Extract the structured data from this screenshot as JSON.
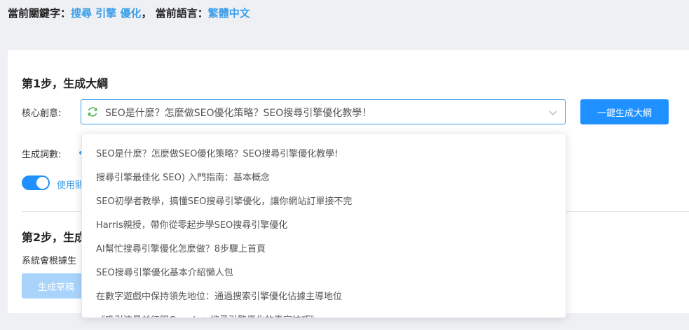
{
  "topbar": {
    "keyword_label": "當前關鍵字：",
    "keyword_value": "搜尋 引擎 優化",
    "separator": "，",
    "language_label": "當前語言：",
    "language_value": "繁體中文"
  },
  "step1": {
    "title": "第1步，生成大綱",
    "core_idea_label": "核心創意:",
    "core_idea_value": "SEO是什麼？怎麼做SEO優化策略？SEO搜尋引擎優化教學！",
    "generate_outline_button": "一鍵生成大綱",
    "word_count_label": "生成詞數:",
    "toggle_label": "使用關",
    "toggle_on": true
  },
  "step2": {
    "title": "第2步，生成",
    "description": "系統會根據生",
    "generate_draft_button": "生成草稿"
  },
  "dropdown": {
    "options": [
      "SEO是什麼？怎麼做SEO優化策略？SEO搜尋引擎優化教學!",
      "搜尋引擎最佳化 SEO) 入門指南：基本概念",
      "SEO初學者教學，搞懂SEO搜尋引擎優化，讓你網站訂單接不完",
      "Harris親授，帶你從零起步學SEO搜尋引擎優化",
      "AI幫忙搜尋引擎優化怎麼做？8步驟上首頁",
      "SEO搜尋引擎優化基本介紹懶人包",
      "在數字遊戲中保持領先地位：通過搜索引擎優化佔據主導地位",
      "《吸引流量並征服Google：搜尋引擎優化的專家技巧》"
    ]
  },
  "colors": {
    "accent": "#1e90ff",
    "highlight_text": "#3d9ee8",
    "disabled_button": "#a8d3fb",
    "page_bg": "#eef0f4"
  }
}
